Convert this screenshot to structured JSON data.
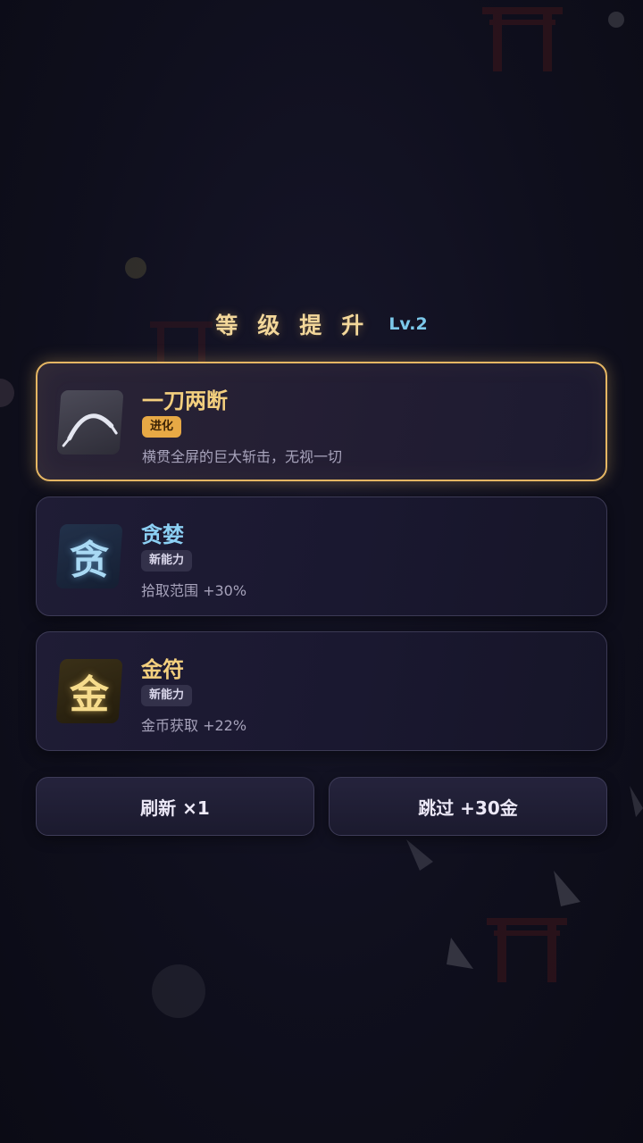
{
  "header": {
    "title": "等级提升",
    "level": "Lv.2"
  },
  "choices": [
    {
      "name": "一刀两断",
      "tag": "进化",
      "desc": "横贯全屏的巨大斩击，无视一切",
      "icon": "slash-arc-icon",
      "selected": true
    },
    {
      "name": "贪婪",
      "tag": "新能力",
      "desc": "拾取范围 +30%",
      "icon_glyph": "贪",
      "icon": "greed-glyph-icon"
    },
    {
      "name": "金符",
      "tag": "新能力",
      "desc": "金币获取 +22%",
      "icon_glyph": "金",
      "icon": "gold-glyph-icon"
    }
  ],
  "actions": {
    "refresh_label": "刷新 ×1",
    "skip_label": "跳过 +30金"
  },
  "colors": {
    "accent_gold": "#e5b663",
    "accent_blue": "#7cc8ea",
    "tag_evolve": "#e7a945"
  }
}
